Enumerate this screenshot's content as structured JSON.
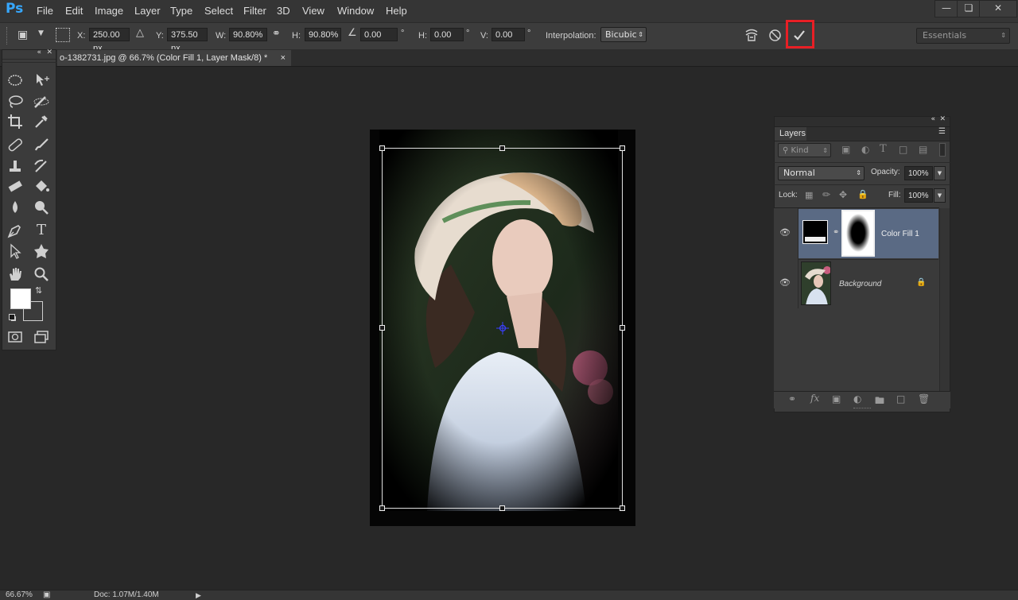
{
  "app": {
    "logo": "Ps",
    "menu": [
      "File",
      "Edit",
      "Image",
      "Layer",
      "Type",
      "Select",
      "Filter",
      "3D",
      "View",
      "Window",
      "Help"
    ],
    "window_controls": [
      "minimize-icon",
      "restore-icon",
      "close-icon"
    ]
  },
  "options_bar": {
    "x_label": "X:",
    "x_value": "250.00 px",
    "y_label": "Y:",
    "y_value": "375.50 px",
    "w_label": "W:",
    "w_value": "90.80%",
    "h_label": "H:",
    "h_value": "90.80%",
    "angle_value": "0.00",
    "angle_unit": "°",
    "hskew_label": "H:",
    "hskew_value": "0.00",
    "vskew_label": "V:",
    "vskew_value": "0.00",
    "interpolation_label": "Interpolation:",
    "interpolation_value": "Bicubic",
    "workspace": "Essentials",
    "commit_icon": "checkmark-icon",
    "cancel_icon": "cancel-icon",
    "highlight_color": "#e81f25"
  },
  "document": {
    "tab_title": "o-1382731.jpg @ 66.7% (Color Fill 1, Layer Mask/8) *",
    "tab_close": "×"
  },
  "toolbar": {
    "tools": [
      [
        "elliptical-marquee-icon",
        "move-icon"
      ],
      [
        "lasso-icon",
        "quick-selection-icon"
      ],
      [
        "crop-icon",
        "eyedropper-icon"
      ],
      [
        "healing-brush-icon",
        "brush-icon"
      ],
      [
        "clone-stamp-icon",
        "history-brush-icon"
      ],
      [
        "eraser-icon",
        "paint-bucket-icon"
      ],
      [
        "blur-icon",
        "dodge-icon"
      ],
      [
        "pen-icon",
        "type-icon"
      ],
      [
        "path-selection-icon",
        "custom-shape-icon"
      ],
      [
        "hand-icon",
        "zoom-icon"
      ]
    ],
    "type_glyph": "T",
    "foreground_color": "#ffffff",
    "background_color": "#3b3b3b"
  },
  "layers_panel": {
    "tab": "Layers",
    "filter_kind": "Kind",
    "blend_mode": "Normal",
    "opacity_label": "Opacity:",
    "opacity_value": "100%",
    "lock_label": "Lock:",
    "fill_label": "Fill:",
    "fill_value": "100%",
    "layers": [
      {
        "name": "Color Fill 1",
        "selected": true
      },
      {
        "name": "Background",
        "selected": false
      }
    ],
    "selected_row_color": "#5a6a84"
  },
  "status": {
    "zoom": "66.67%",
    "doc_info": "Doc: 1.07M/1.40M"
  }
}
